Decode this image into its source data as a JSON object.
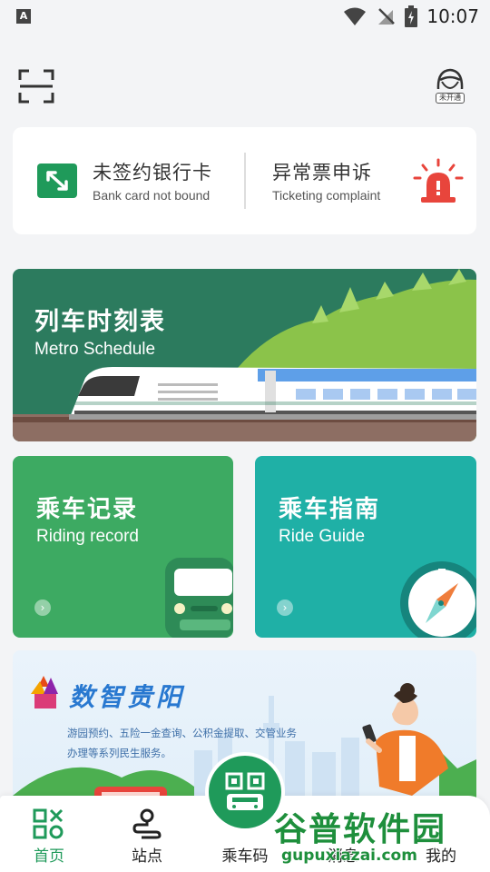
{
  "status_bar": {
    "time": "10:07",
    "app_indicator": "A",
    "icons": [
      "wifi-icon",
      "no-signal-icon",
      "battery-charging-icon"
    ]
  },
  "header": {
    "scan_icon": "scan-icon",
    "avatar_tag": "未开通"
  },
  "quick_cards": {
    "bank": {
      "title": "未签约银行卡",
      "subtitle": "Bank card not bound",
      "icon": "bank-card-icon"
    },
    "complaint": {
      "title": "异常票申诉",
      "subtitle": "Ticketing complaint",
      "icon": "alarm-icon"
    }
  },
  "metro_schedule": {
    "title": "列车时刻表",
    "subtitle": "Metro Schedule"
  },
  "tiles": {
    "riding_record": {
      "title": "乘车记录",
      "subtitle": "Riding record"
    },
    "ride_guide": {
      "title": "乘车指南",
      "subtitle": "Ride Guide"
    }
  },
  "banner": {
    "title": "数智贵阳",
    "text": "游园预约、五险一金查询、公积金提取、交管业务办理等系列民生服务。"
  },
  "tabbar": {
    "items": [
      {
        "label": "首页",
        "icon": "home-grid-icon",
        "active": true
      },
      {
        "label": "站点",
        "icon": "station-route-icon",
        "active": false
      },
      {
        "label": "乘车码",
        "icon": "ride-qr-icon",
        "active": false
      },
      {
        "label": "消息",
        "icon": "message-icon",
        "active": false
      },
      {
        "label": "我的",
        "icon": "profile-icon",
        "active": false
      }
    ]
  },
  "watermark": {
    "text": "谷普软件园",
    "url": "gupuxiazai.com"
  },
  "colors": {
    "primary_green": "#1f9a5a",
    "teal": "#1fb0a6",
    "dark_green": "#2c7b5e",
    "alarm_red": "#e8453c"
  }
}
